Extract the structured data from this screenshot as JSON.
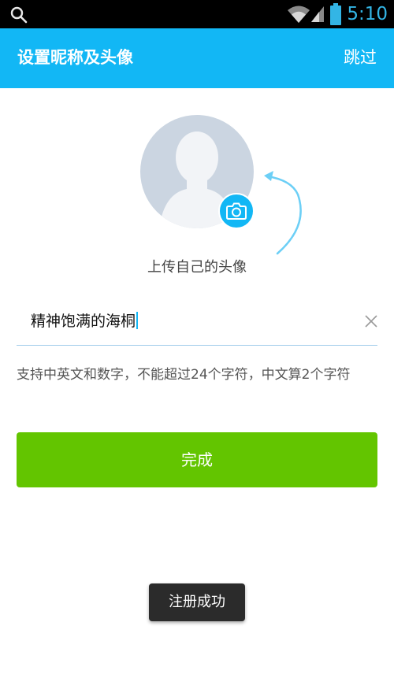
{
  "status_bar": {
    "time": "5:10",
    "icons": [
      "search-icon",
      "wifi-icon",
      "signal-icon",
      "battery-icon"
    ],
    "accent_color": "#33b5e5"
  },
  "header": {
    "title": "设置昵称及头像",
    "skip_label": "跳过",
    "background_color": "#12b7f5"
  },
  "avatar": {
    "placeholder_icon": "default-avatar-icon",
    "badge_icon": "camera-icon",
    "upload_label": "上传自己的头像"
  },
  "nickname": {
    "value": "精神饱满的海桐",
    "clear_icon": "clear-icon"
  },
  "hint": "支持中英文和数字，不能超过24个字符，中文算2个字符",
  "done_button": {
    "label": "完成",
    "color": "#63c500"
  },
  "toast": "注册成功"
}
